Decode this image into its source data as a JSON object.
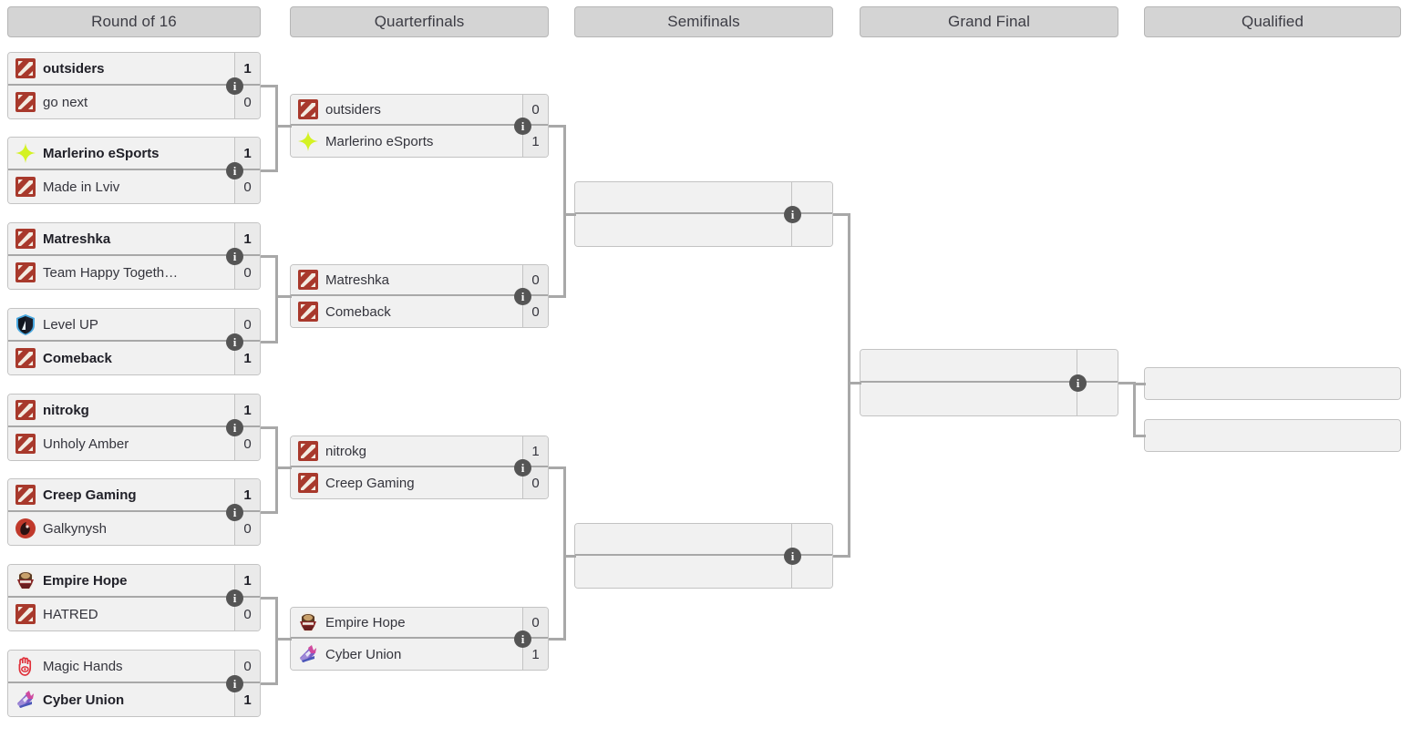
{
  "rounds": [
    {
      "label": "Round of 16"
    },
    {
      "label": "Quarterfinals"
    },
    {
      "label": "Semifinals"
    },
    {
      "label": "Grand Final"
    },
    {
      "label": "Qualified"
    }
  ],
  "info_glyph": "i",
  "colors": {
    "header_bg": "#d4d4d4",
    "box_bg": "#f1f1f1",
    "score_bg": "#eaeaea",
    "border": "#c3c3c3",
    "connector": "#a8a8a8",
    "info_badge": "#555555",
    "text": "#34343c",
    "dota_logo": "#a8392c",
    "marlerino_logo": "#d4f224",
    "levelup_logo": "#2a7fbf",
    "galkynysh_logo": "#c0392b",
    "empire_logo": "#8a2a2a",
    "magichands_logo": "#e0303a",
    "cyberunion_logo": "#8e5fd0"
  },
  "round16": [
    {
      "top": {
        "name": "outsiders",
        "score": "1",
        "winner": true,
        "logo": "dota"
      },
      "bottom": {
        "name": "go next",
        "score": "0",
        "winner": false,
        "logo": "dota"
      }
    },
    {
      "top": {
        "name": "Marlerino eSports",
        "score": "1",
        "winner": true,
        "logo": "marlerino"
      },
      "bottom": {
        "name": "Made in Lviv",
        "score": "0",
        "winner": false,
        "logo": "dota"
      }
    },
    {
      "top": {
        "name": "Matreshka",
        "score": "1",
        "winner": true,
        "logo": "dota"
      },
      "bottom": {
        "name": "Team Happy Togeth…",
        "score": "0",
        "winner": false,
        "logo": "dota"
      }
    },
    {
      "top": {
        "name": "Level UP",
        "score": "0",
        "winner": false,
        "logo": "levelup"
      },
      "bottom": {
        "name": "Comeback",
        "score": "1",
        "winner": true,
        "logo": "dota"
      }
    },
    {
      "top": {
        "name": "nitrokg",
        "score": "1",
        "winner": true,
        "logo": "dota"
      },
      "bottom": {
        "name": "Unholy Amber",
        "score": "0",
        "winner": false,
        "logo": "dota"
      }
    },
    {
      "top": {
        "name": "Creep Gaming",
        "score": "1",
        "winner": true,
        "logo": "dota"
      },
      "bottom": {
        "name": "Galkynysh",
        "score": "0",
        "winner": false,
        "logo": "galkynysh"
      }
    },
    {
      "top": {
        "name": "Empire Hope",
        "score": "1",
        "winner": true,
        "logo": "empire"
      },
      "bottom": {
        "name": "HATRED",
        "score": "0",
        "winner": false,
        "logo": "dota"
      }
    },
    {
      "top": {
        "name": "Magic Hands",
        "score": "0",
        "winner": false,
        "logo": "magichands"
      },
      "bottom": {
        "name": "Cyber Union",
        "score": "1",
        "winner": true,
        "logo": "cyberunion"
      }
    }
  ],
  "quarterfinals": [
    {
      "top": {
        "name": "outsiders",
        "score": "0",
        "winner": false,
        "logo": "dota"
      },
      "bottom": {
        "name": "Marlerino eSports",
        "score": "1",
        "winner": false,
        "logo": "marlerino"
      }
    },
    {
      "top": {
        "name": "Matreshka",
        "score": "0",
        "winner": false,
        "logo": "dota"
      },
      "bottom": {
        "name": "Comeback",
        "score": "0",
        "winner": false,
        "logo": "dota"
      }
    },
    {
      "top": {
        "name": "nitrokg",
        "score": "1",
        "winner": false,
        "logo": "dota"
      },
      "bottom": {
        "name": "Creep Gaming",
        "score": "0",
        "winner": false,
        "logo": "dota"
      }
    },
    {
      "top": {
        "name": "Empire Hope",
        "score": "0",
        "winner": false,
        "logo": "empire"
      },
      "bottom": {
        "name": "Cyber Union",
        "score": "1",
        "winner": false,
        "logo": "cyberunion"
      }
    }
  ],
  "semifinals": [
    {
      "top": {
        "name": "",
        "score": ""
      },
      "bottom": {
        "name": "",
        "score": ""
      }
    },
    {
      "top": {
        "name": "",
        "score": ""
      },
      "bottom": {
        "name": "",
        "score": ""
      }
    }
  ],
  "grand_final": [
    {
      "top": {
        "name": "",
        "score": ""
      },
      "bottom": {
        "name": "",
        "score": ""
      }
    }
  ],
  "qualified": [
    {
      "name": ""
    },
    {
      "name": ""
    }
  ]
}
